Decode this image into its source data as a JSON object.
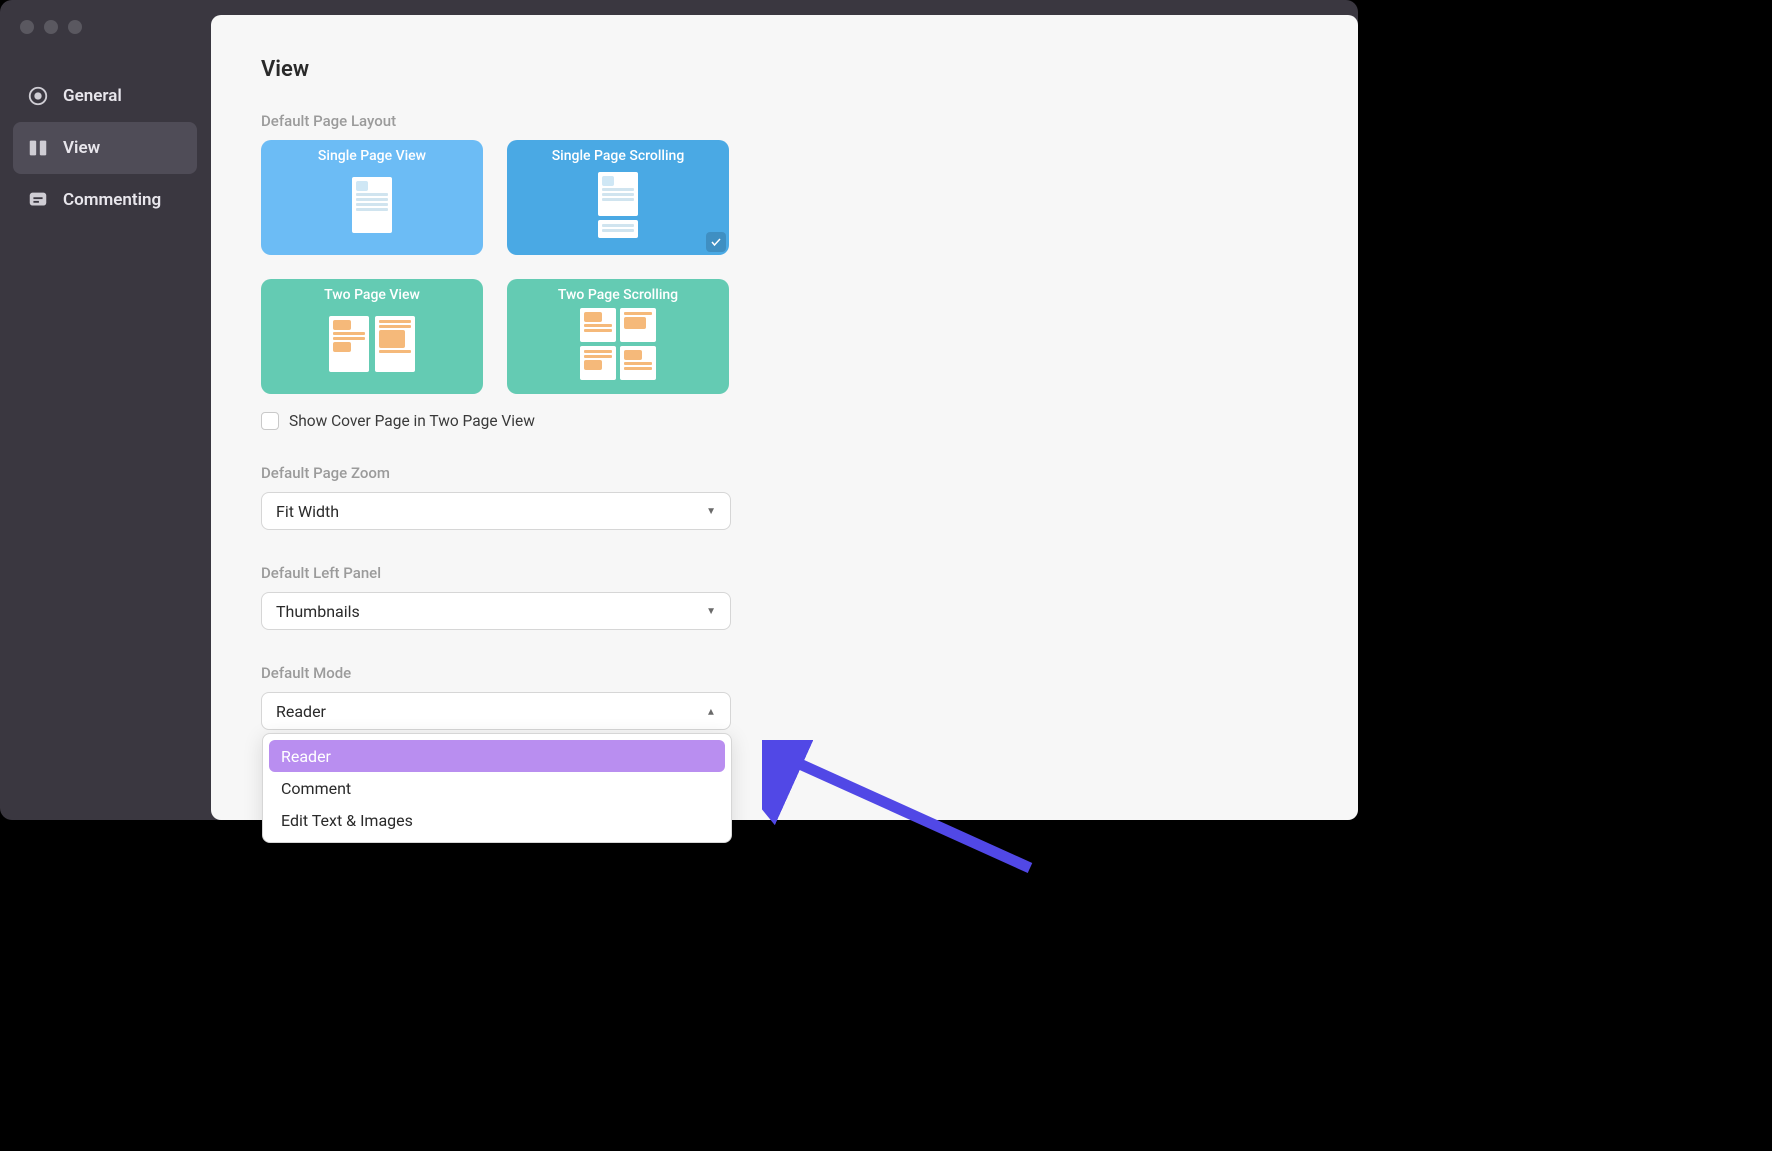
{
  "sidebar": {
    "items": [
      {
        "label": "General"
      },
      {
        "label": "View"
      },
      {
        "label": "Commenting"
      }
    ],
    "active_index": 1
  },
  "page": {
    "title": "View"
  },
  "defaultPageLayout": {
    "label": "Default Page Layout",
    "options": [
      {
        "label": "Single Page View"
      },
      {
        "label": "Single Page Scrolling"
      },
      {
        "label": "Two Page View"
      },
      {
        "label": "Two Page Scrolling"
      }
    ],
    "selected_index": 1
  },
  "showCover": {
    "label": "Show Cover Page in Two Page View",
    "checked": false
  },
  "defaultPageZoom": {
    "label": "Default Page Zoom",
    "value": "Fit Width"
  },
  "defaultLeftPanel": {
    "label": "Default Left Panel",
    "value": "Thumbnails"
  },
  "defaultMode": {
    "label": "Default Mode",
    "value": "Reader",
    "open": true,
    "options": [
      "Reader",
      "Comment",
      "Edit Text & Images"
    ],
    "highlight_index": 0
  }
}
